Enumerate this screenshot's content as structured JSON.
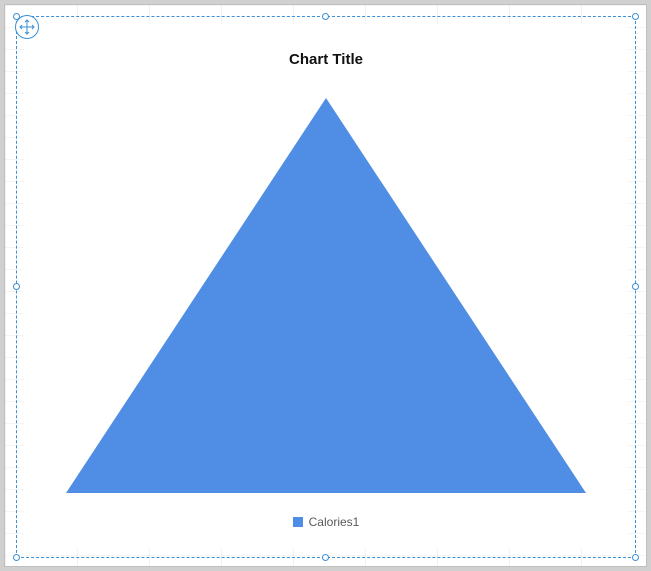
{
  "chart": {
    "title": "Chart Title",
    "legend": {
      "items": [
        {
          "label": "Calories1",
          "color": "#4F8EE4"
        }
      ]
    }
  },
  "chart_data": {
    "type": "area",
    "title": "Chart Title",
    "series": [
      {
        "name": "Calories1",
        "color": "#4F8EE4"
      }
    ]
  }
}
